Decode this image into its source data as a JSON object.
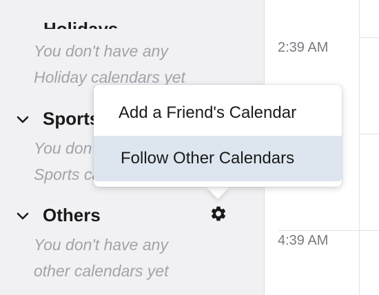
{
  "sidebar": {
    "cutoff_heading": "Holidays",
    "holidays_note_line1": "You don't have any",
    "holidays_note_line2": "Holiday calendars yet",
    "sports": {
      "title": "Sports",
      "note_line1": "You don't have any",
      "note_line2": "Sports calendars yet"
    },
    "others": {
      "title": "Others",
      "note_line1": "You don't have any",
      "note_line2": "other calendars yet"
    },
    "settings_icon": "gear-icon"
  },
  "grid": {
    "times": [
      "2:39 AM",
      "4:39 AM"
    ]
  },
  "popup_menu": {
    "items": [
      {
        "label": "Add a Friend's Calendar",
        "highlighted": false
      },
      {
        "label": "Follow Other Calendars",
        "highlighted": true
      }
    ],
    "highlight_color": "#dde6ef"
  }
}
